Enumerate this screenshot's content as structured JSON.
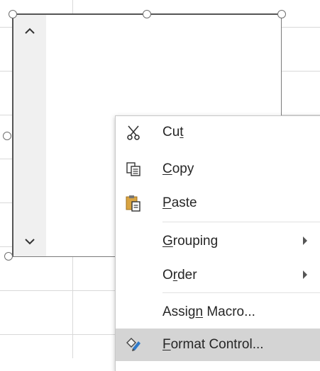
{
  "control": {
    "scroll_up_icon": "chevron-up",
    "scroll_down_icon": "chevron-down"
  },
  "menu": {
    "items": [
      {
        "id": "cut",
        "pre": "Cu",
        "ul": "t",
        "post": "",
        "icon": "scissors-icon"
      },
      {
        "id": "copy",
        "pre": "",
        "ul": "C",
        "post": "opy",
        "icon": "copy-icon"
      },
      {
        "id": "paste",
        "pre": "",
        "ul": "P",
        "post": "aste",
        "icon": "paste-icon"
      },
      {
        "id": "grouping",
        "pre": "",
        "ul": "G",
        "post": "rouping",
        "submenu": true
      },
      {
        "id": "order",
        "pre": "O",
        "ul": "r",
        "post": "der",
        "submenu": true
      },
      {
        "id": "assign-macro",
        "pre": "Assig",
        "ul": "n",
        "post": " Macro..."
      },
      {
        "id": "format-control",
        "pre": "",
        "ul": "F",
        "post": "ormat Control...",
        "icon": "format-control-icon",
        "highlighted": true
      }
    ]
  },
  "colors": {
    "highlight": "#d4d4d4",
    "paste_icon": "#d9a441",
    "text": "#262626"
  }
}
